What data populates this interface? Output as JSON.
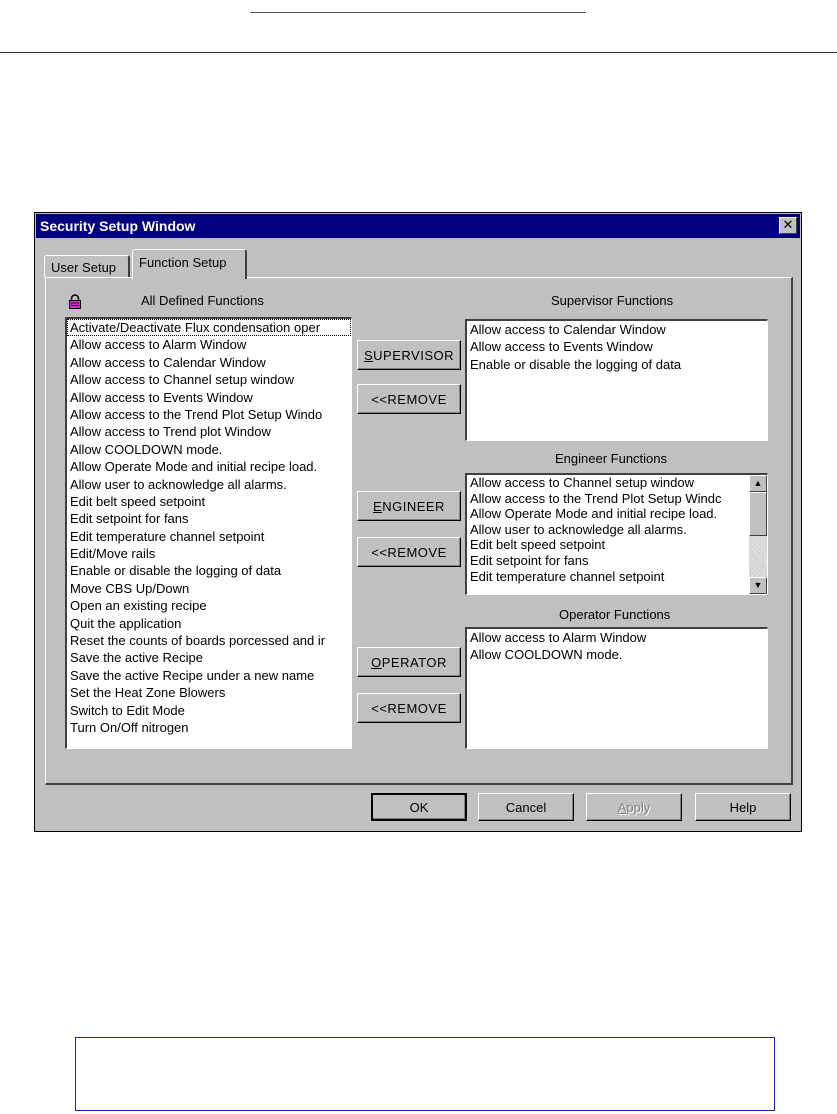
{
  "window": {
    "title": "Security Setup Window",
    "close_glyph": "✕"
  },
  "tabs": [
    {
      "label": "User Setup",
      "selected": false
    },
    {
      "label": "Function Setup",
      "selected": true
    }
  ],
  "lock_icon": {
    "icon": "lock-icon",
    "color": "#cc33cc"
  },
  "all_functions": {
    "label": "All Defined Functions",
    "items": [
      "Activate/Deactivate Flux condensation oper",
      "Allow access to Alarm Window",
      "Allow access to Calendar Window",
      "Allow access to Channel setup window",
      "Allow access to Events Window",
      "Allow access to the Trend Plot Setup Windo",
      "Allow access to Trend plot Window",
      "Allow COOLDOWN mode.",
      "Allow Operate Mode and initial recipe load.",
      "Allow user to acknowledge all alarms.",
      "Edit belt speed setpoint",
      "Edit setpoint for fans",
      "Edit temperature channel setpoint",
      "Edit/Move rails",
      "Enable or disable the logging of data",
      "Move CBS Up/Down",
      "Open an existing recipe",
      "Quit the application",
      "Reset the counts of boards porcessed and ir",
      "Save the active Recipe",
      "Save the active Recipe under a new name",
      "Set the Heat Zone Blowers",
      "Switch to Edit Mode",
      "Turn On/Off nitrogen"
    ]
  },
  "supervisor": {
    "label": "Supervisor Functions",
    "add_button": {
      "mnemonic": "S",
      "rest": "UPERVISOR"
    },
    "remove_button": "<<REMOVE",
    "items": [
      "Allow access to Calendar Window",
      "Allow access to Events Window",
      "Enable or disable the logging of data"
    ]
  },
  "engineer": {
    "label": "Engineer Functions",
    "add_button": {
      "mnemonic": "E",
      "rest": "NGINEER"
    },
    "remove_button": "<<REMOVE",
    "items": [
      "Allow access to Channel setup window",
      "Allow access to the Trend Plot Setup Windc",
      "Allow Operate Mode and initial recipe load.",
      "Allow user to acknowledge all alarms.",
      "Edit belt speed setpoint",
      "Edit setpoint for fans",
      "Edit temperature channel setpoint"
    ],
    "scroll_up_glyph": "▲",
    "scroll_down_glyph": "▼"
  },
  "operator": {
    "label": "Operator Functions",
    "add_button": {
      "mnemonic": "O",
      "rest": "PERATOR"
    },
    "remove_button": "<<REMOVE",
    "items": [
      "Allow access to Alarm Window",
      "Allow COOLDOWN mode."
    ]
  },
  "footer": {
    "ok": "OK",
    "cancel": "Cancel",
    "apply": {
      "mnemonic": "A",
      "rest": "pply",
      "disabled": true
    },
    "help": "Help"
  }
}
